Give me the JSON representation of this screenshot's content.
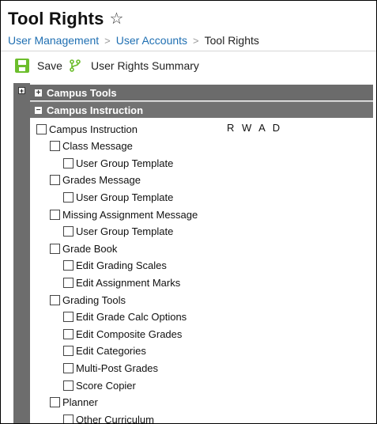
{
  "header": {
    "title": "Tool Rights",
    "breadcrumb": [
      "User Management",
      "User Accounts",
      "Tool Rights"
    ],
    "separator": ">"
  },
  "toolbar": {
    "save_label": "Save",
    "summary_label": "User Rights Summary"
  },
  "categories": {
    "campus_tools": "Campus Tools",
    "campus_instruction": "Campus Instruction",
    "collapsed_glyph": "+",
    "expanded_glyph": "−"
  },
  "rights_header": "R  W  A  D",
  "tree": [
    {
      "label": "Campus Instruction",
      "level": 0
    },
    {
      "label": "Class Message",
      "level": 1
    },
    {
      "label": "User Group Template",
      "level": 2
    },
    {
      "label": "Grades Message",
      "level": 1
    },
    {
      "label": "User Group Template",
      "level": 2
    },
    {
      "label": "Missing Assignment Message",
      "level": 1
    },
    {
      "label": "User Group Template",
      "level": 2
    },
    {
      "label": "Grade Book",
      "level": 1
    },
    {
      "label": "Edit Grading Scales",
      "level": 2
    },
    {
      "label": "Edit Assignment Marks",
      "level": 2
    },
    {
      "label": "Grading Tools",
      "level": 1
    },
    {
      "label": "Edit Grade Calc Options",
      "level": 2
    },
    {
      "label": "Edit Composite Grades",
      "level": 2
    },
    {
      "label": "Edit Categories",
      "level": 2
    },
    {
      "label": "Multi-Post Grades",
      "level": 2
    },
    {
      "label": "Score Copier",
      "level": 2
    },
    {
      "label": "Planner",
      "level": 1
    },
    {
      "label": "Other Curriculum",
      "level": 2
    }
  ],
  "colors": {
    "accent_link": "#1f6fb2",
    "save_green": "#6cbe2c",
    "category_bar": "#6b6b6b"
  }
}
